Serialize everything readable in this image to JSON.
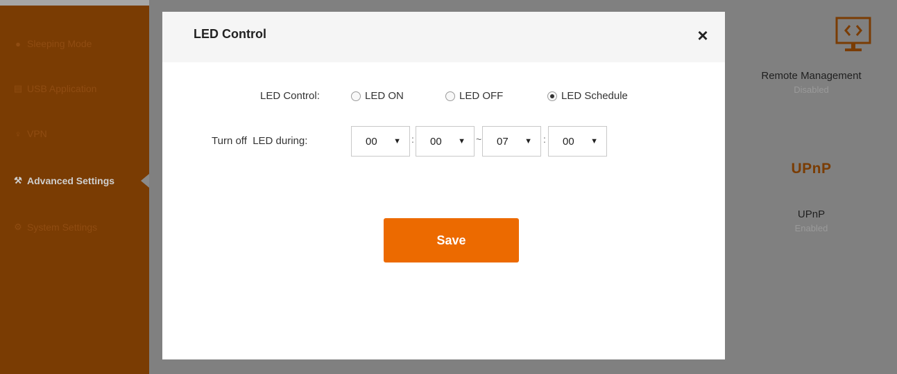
{
  "sidebar": {
    "items": [
      {
        "label": "Sleeping Mode",
        "icon": "bulb-icon",
        "glyph": "💡"
      },
      {
        "label": "USB Application",
        "icon": "usb-icon",
        "glyph": "⎍"
      },
      {
        "label": "VPN",
        "icon": "vpn-icon",
        "glyph": "⚲"
      },
      {
        "label": "Advanced Settings",
        "icon": "wrench-icon",
        "glyph": "⚒"
      },
      {
        "label": "System Settings",
        "icon": "gear-icon",
        "glyph": "⚙"
      }
    ]
  },
  "right_panel": {
    "remote": {
      "name": "Remote Management",
      "status": "Disabled",
      "icon": "monitor-icon"
    },
    "upnp": {
      "name": "UPnP",
      "status": "Enabled",
      "logo": "UPnP"
    }
  },
  "modal": {
    "title": "LED Control",
    "close_icon": "close-icon",
    "led_control_label": "LED Control:",
    "options": [
      {
        "label": "LED ON",
        "checked": false
      },
      {
        "label": "LED OFF",
        "checked": false
      },
      {
        "label": "LED Schedule",
        "checked": true
      }
    ],
    "turn_off_label": "Turn off  LED during:",
    "schedule": {
      "start_hour": "00",
      "start_minute": "00",
      "end_hour": "07",
      "end_minute": "00",
      "colon": ":",
      "tilde": "~"
    },
    "save_label": "Save"
  },
  "colors": {
    "accent": "#ec6a00",
    "sidebar": "#7a3c03",
    "overlay": "#808080"
  }
}
